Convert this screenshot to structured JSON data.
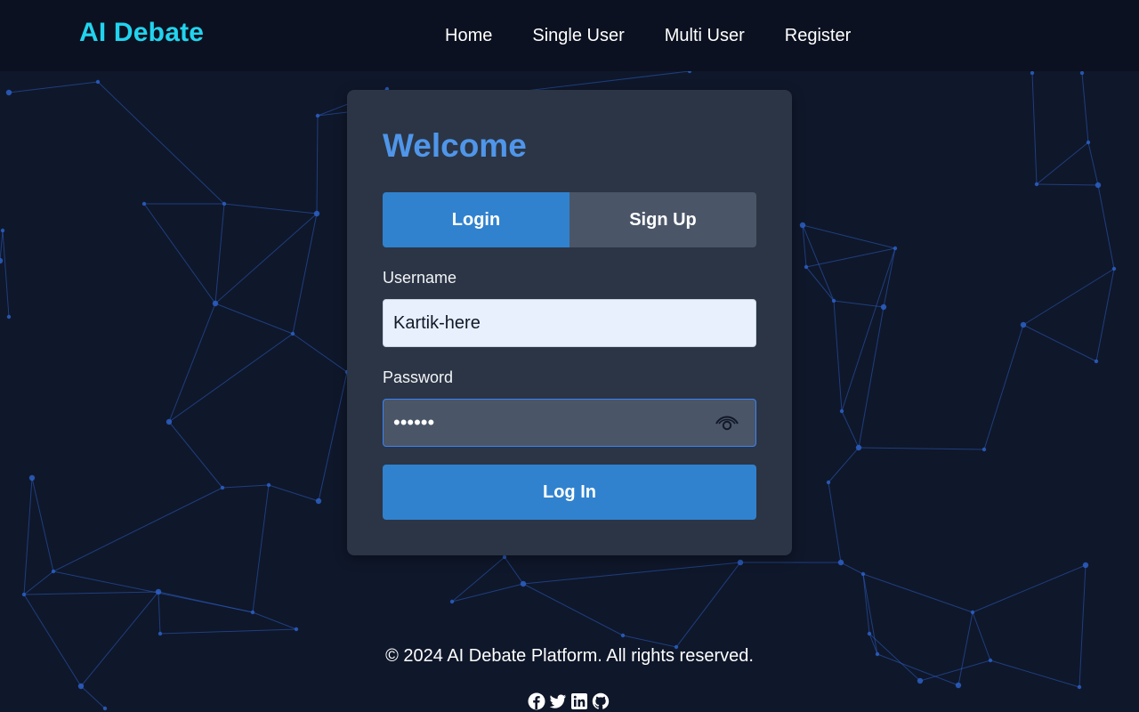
{
  "brand": "AI Debate",
  "nav": {
    "home": "Home",
    "single": "Single User",
    "multi": "Multi User",
    "register": "Register"
  },
  "card": {
    "title": "Welcome",
    "tabs": {
      "login": "Login",
      "signup": "Sign Up",
      "active": "Login"
    },
    "username": {
      "label": "Username",
      "value": "Kartik-here"
    },
    "password": {
      "label": "Password",
      "masked": "••••••"
    },
    "submit": "Log In"
  },
  "footer": {
    "copyright": "© 2024 AI Debate Platform. All rights reserved.",
    "social": [
      "facebook-icon",
      "twitter-icon",
      "linkedin-icon",
      "github-icon"
    ]
  },
  "colors": {
    "background": "#0f172a",
    "navbar": "#0b1120",
    "brand": "#22d3ee",
    "card": "#2b3545",
    "title": "#4f96ea",
    "primary": "#3182ce",
    "tab_inactive": "#4a5568",
    "network": "#2c5fc4"
  }
}
